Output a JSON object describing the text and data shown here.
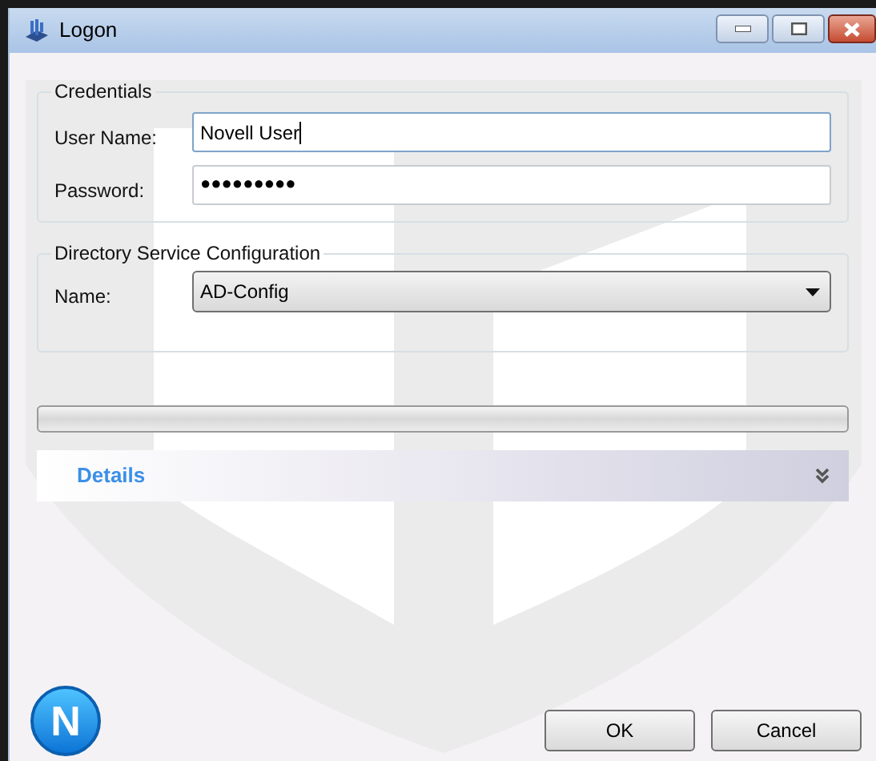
{
  "window": {
    "title": "Logon"
  },
  "credentials": {
    "title": "Credentials",
    "user_name_label": "User Name:",
    "user_name": "Novell User",
    "password_label": "Password:",
    "password": "●●●●●●●●●"
  },
  "directory": {
    "title": "Directory Service Configuration",
    "name_label": "Name:",
    "name_value": "AD-Config"
  },
  "progress": {
    "level": 0
  },
  "details": {
    "label": "Details",
    "expanded": false
  },
  "logo": {
    "letter": "N"
  },
  "buttons": [
    "OK",
    "Cancel"
  ]
}
